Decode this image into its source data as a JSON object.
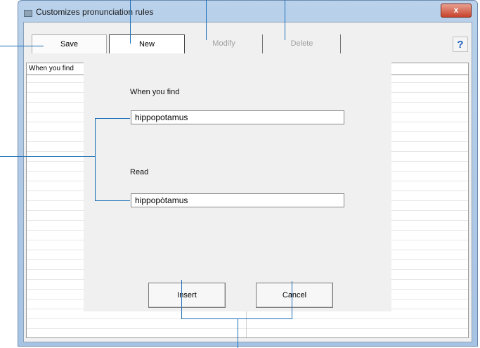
{
  "window": {
    "title": "Customizes pronunciation rules",
    "close_label": "x"
  },
  "toolbar": {
    "save_label": "Save",
    "new_label": "New",
    "modify_label": "Modify",
    "delete_label": "Delete",
    "help_label": "?"
  },
  "grid": {
    "header": "When you find"
  },
  "form": {
    "find_label": "When you find",
    "find_value": "hippopotamus",
    "read_label": "Read",
    "read_value": "hippopòtamus",
    "insert_label": "Insert",
    "cancel_label": "Cancel"
  },
  "colors": {
    "callout": "#1c6fb8",
    "close_button": "#c7432c"
  }
}
